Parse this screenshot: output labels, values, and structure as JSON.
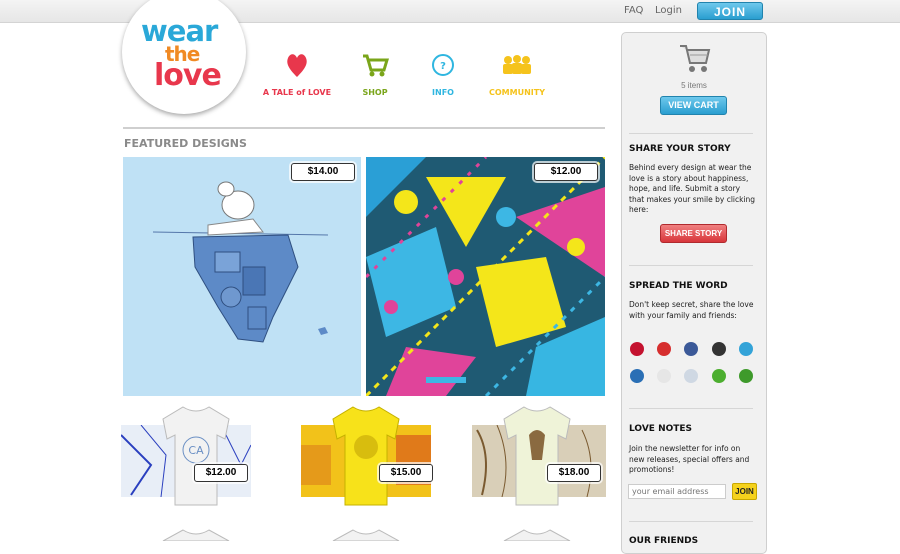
{
  "header": {
    "links": [
      {
        "label": "FAQ"
      },
      {
        "label": "Login"
      }
    ],
    "join_label": "JOIN"
  },
  "logo": {
    "line1": "wear",
    "line2": "the",
    "line3": "love"
  },
  "nav": [
    {
      "label": "A TALE of LOVE",
      "icon": "heart-icon",
      "color": "#e8374c"
    },
    {
      "label": "SHOP",
      "icon": "shopping-cart-icon",
      "color": "#7aa51a"
    },
    {
      "label": "INFO",
      "icon": "info-icon",
      "color": "#2fb6e0"
    },
    {
      "label": "COMMUNITY",
      "icon": "community-people-icon",
      "color": "#f5c31c"
    }
  ],
  "featured": {
    "title": "FEATURED DESIGNS",
    "items": [
      {
        "price": "$14.00",
        "design": "polar bear on iceberg"
      },
      {
        "price": "$12.00",
        "design": "colorful geometric pattern"
      }
    ]
  },
  "tees": [
    {
      "price": "$12.00",
      "shirt_color": "#f2f2f2"
    },
    {
      "price": "$15.00",
      "shirt_color": "#f7e21a"
    },
    {
      "price": "$18.00",
      "shirt_color": "#eff3d8"
    }
  ],
  "sidebar": {
    "cart": {
      "items_text": "5 items",
      "button": "VIEW CART"
    },
    "share": {
      "title": "SHARE YOUR STORY",
      "text": "Behind every design at wear the love is a story about happiness, hope, and life. Submit a story that makes your smile by clicking here:",
      "button": "SHARE STORY"
    },
    "spread": {
      "title": "SPREAD THE WORD",
      "text": "Don't keep secret, share the love with your family and friends:",
      "icons": [
        {
          "name": "yahoo-icon",
          "color": "#c4122f"
        },
        {
          "name": "youtube-icon",
          "color": "#d62e2e"
        },
        {
          "name": "facebook-icon",
          "color": "#3b5998"
        },
        {
          "name": "myspace-icon",
          "color": "#333333"
        },
        {
          "name": "twitter-icon",
          "color": "#33a3d8"
        },
        {
          "name": "delicious-icon",
          "color": "#2a6fb5"
        },
        {
          "name": "flickr-icon",
          "color": "#e6e6e6"
        },
        {
          "name": "reddit-icon",
          "color": "#cfd8e3"
        },
        {
          "name": "technorati-icon",
          "color": "#4cae2f"
        },
        {
          "name": "stumbleupon-icon",
          "color": "#3e9a2b"
        }
      ]
    },
    "newsletter": {
      "title": "LOVE NOTES",
      "text": "Join the newsletter for info on new releases, special offers and promotions!",
      "placeholder": "your email address",
      "button": "JOIN"
    },
    "friends": {
      "title": "OUR FRIENDS"
    }
  }
}
